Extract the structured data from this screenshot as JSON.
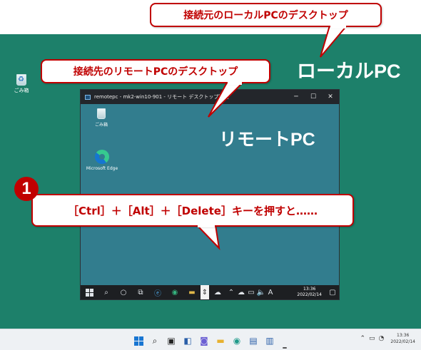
{
  "callouts": {
    "local_desktop": "接続元のローカルPCのデスクトップ",
    "remote_desktop": "接続先のリモートPCのデスクトップ",
    "instruction": "［Ctrl］＋［Alt］＋［Delete］キーを押すと……",
    "step_number": "1"
  },
  "labels": {
    "local_pc": "ローカルPC",
    "remote_pc": "リモートPC"
  },
  "local_desktop": {
    "background_color": "#1d806a",
    "icons": [
      {
        "name": "recycle-bin",
        "label": "ごみ箱"
      }
    ]
  },
  "remote_window": {
    "title": "remotepc - mk2-win10-901 - リモート デスクトップ接続",
    "controls": {
      "minimize": "─",
      "maximize": "☐",
      "close": "✕"
    },
    "desktop_icons": [
      {
        "name": "recycle-bin",
        "label": "ごみ箱"
      },
      {
        "name": "microsoft-edge",
        "label": "Microsoft Edge"
      }
    ],
    "taskbar": {
      "clock_time": "13:36",
      "clock_date": "2022/02/14",
      "ime": "A"
    }
  },
  "local_taskbar": {
    "clock_time": "13:36",
    "clock_date": "2022/02/14"
  },
  "colors": {
    "accent_red": "#c00000",
    "local_desktop": "#1d806a",
    "remote_desktop": "#327d8e"
  }
}
